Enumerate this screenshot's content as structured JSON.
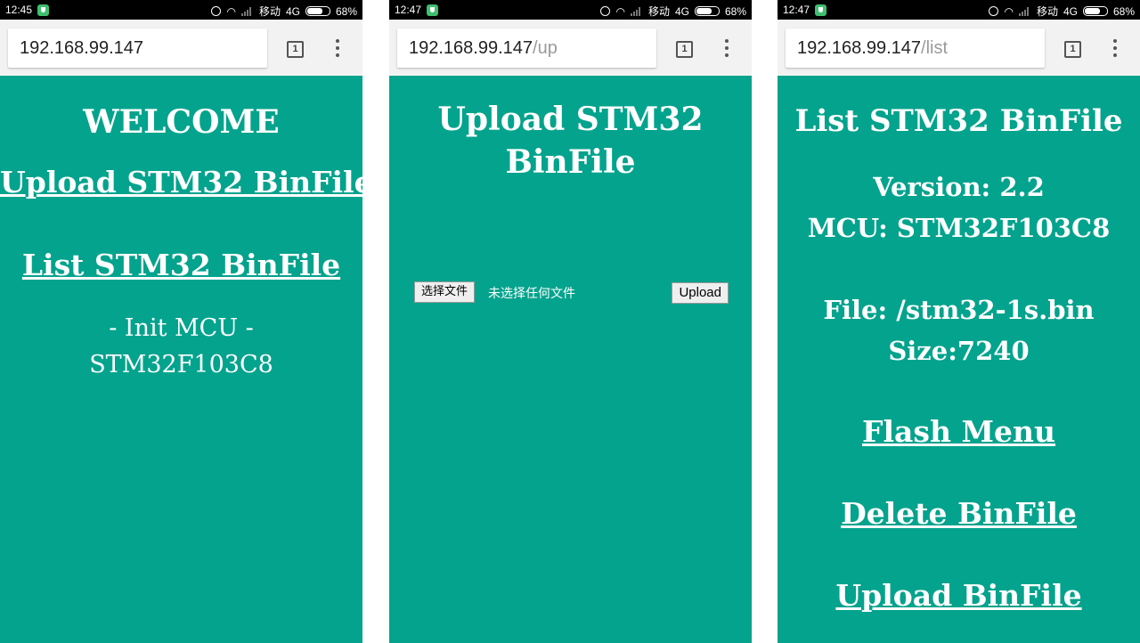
{
  "screens": [
    {
      "status": {
        "time": "12:45",
        "carrier": "移动",
        "network": "4G",
        "battery": "68%"
      },
      "url": {
        "host": "192.168.99.147",
        "path": ""
      },
      "tab_count": "1",
      "title": "WELCOME",
      "links": [
        "Upload STM32 BinFile ",
        "List STM32 BinFile"
      ],
      "lines": [
        "- Init MCU -",
        "STM32F103C8"
      ]
    },
    {
      "status": {
        "time": "12:47",
        "carrier": "移动",
        "network": "4G",
        "battery": "68%"
      },
      "url": {
        "host": "192.168.99.147",
        "path": "/up"
      },
      "tab_count": "1",
      "title_lines": [
        "Upload STM32",
        "BinFile"
      ],
      "file_button": "选择文件",
      "no_file_text": "未选择任何文件",
      "upload_button": "Upload"
    },
    {
      "status": {
        "time": "12:47",
        "carrier": "移动",
        "network": "4G",
        "battery": "68%"
      },
      "url": {
        "host": "192.168.99.147",
        "path": "/list"
      },
      "tab_count": "1",
      "title": "List STM32 BinFile",
      "info_lines": [
        "Version: 2.2",
        "MCU: STM32F103C8",
        "File: /stm32-1s.bin",
        "Size:7240"
      ],
      "links": [
        "Flash Menu",
        "Delete BinFile ",
        "Upload BinFile"
      ]
    }
  ],
  "colors": {
    "background": "#04a38d",
    "statusbar": "#000000",
    "toolbar": "#f2f2f2"
  }
}
